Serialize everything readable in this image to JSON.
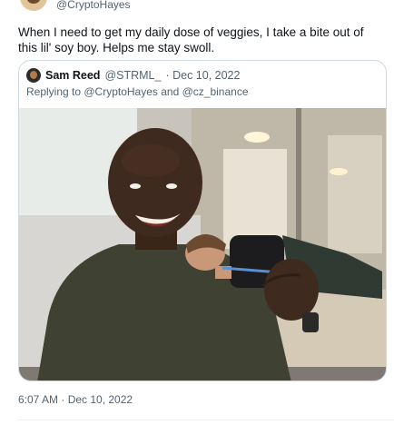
{
  "author": {
    "handle": "@CryptoHayes",
    "avatar_icon": "profile-avatar"
  },
  "tweet": {
    "text": "When I need to get my daily dose of veggies, I take a bite out of this lil' soy boy. Helps me stay swoll.",
    "timestamp": "6:07 AM · Dec 10, 2022"
  },
  "quoted_tweet": {
    "name": "Sam Reed",
    "handle": "@STRML_",
    "date": "· Dec 10, 2022",
    "replying_to": "Replying to @CryptoHayes and @cz_binance",
    "avatar_icon": "profile-avatar"
  },
  "colors": {
    "text": "#0f1419",
    "muted": "#536471",
    "border": "#cfd9de"
  }
}
